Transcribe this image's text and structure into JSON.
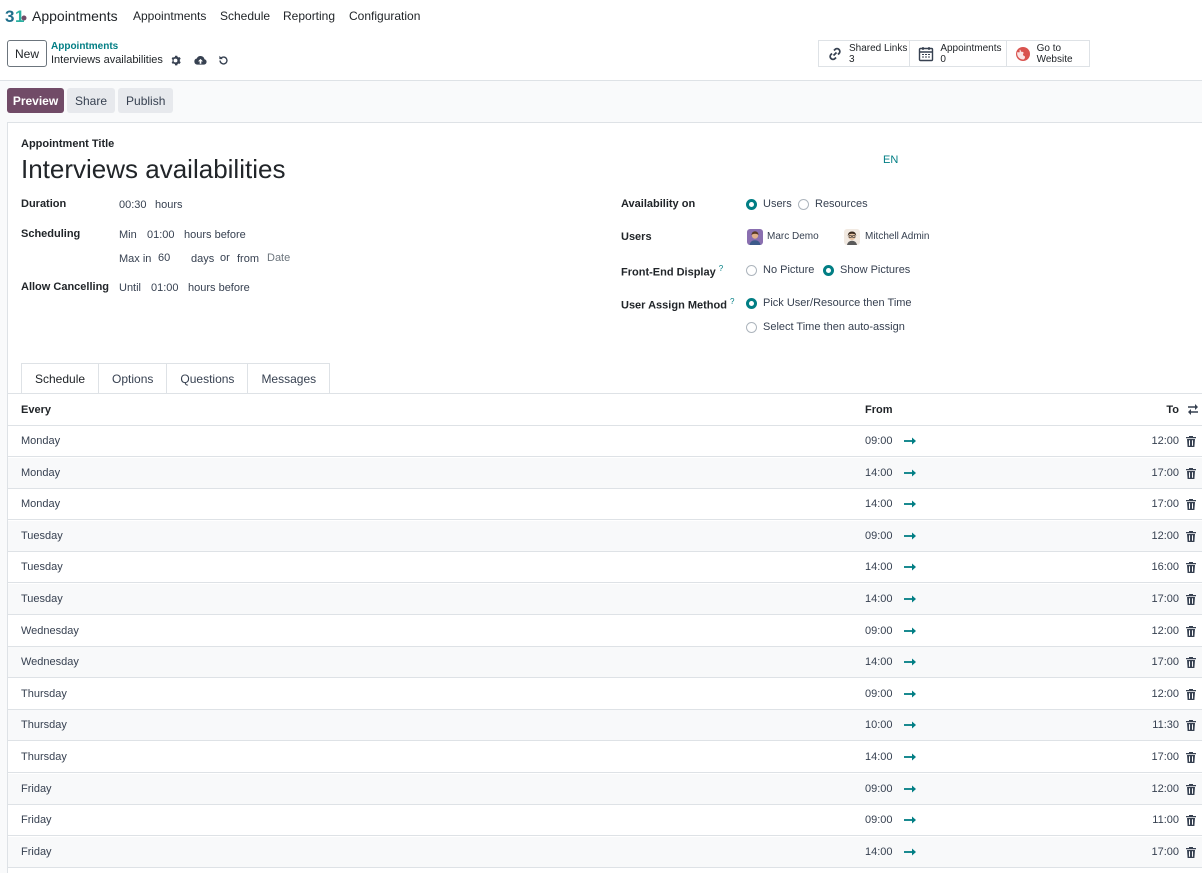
{
  "topnav": {
    "app_name": "Appointments",
    "items": [
      "Appointments",
      "Schedule",
      "Reporting",
      "Configuration"
    ]
  },
  "control": {
    "new_label": "New",
    "breadcrumb_parent": "Appointments",
    "breadcrumb_current": "Interviews availabilities",
    "smart_buttons": [
      {
        "line1": "Shared Links",
        "line2": "3",
        "icon": "link-icon"
      },
      {
        "line1": "Appointments",
        "line2": "0",
        "icon": "calendar-icon"
      },
      {
        "line1": "Go to",
        "line2": "Website",
        "icon": "globe-icon"
      }
    ]
  },
  "statusbar": {
    "preview": "Preview",
    "share": "Share",
    "publish": "Publish"
  },
  "form": {
    "title_label": "Appointment Title",
    "title": "Interviews availabilities",
    "lang": "EN",
    "duration": {
      "label": "Duration",
      "value": "00:30",
      "unit": "hours"
    },
    "scheduling": {
      "label": "Scheduling",
      "min_label": "Min",
      "min_value": "01:00",
      "min_suffix": "hours before",
      "max_label": "Max in",
      "max_value": "60",
      "max_days": "days",
      "or": "or",
      "from": "from",
      "date_placeholder": "Date"
    },
    "cancelling": {
      "label": "Allow Cancelling",
      "until": "Until",
      "value": "01:00",
      "suffix": "hours before"
    },
    "availability": {
      "label": "Availability on",
      "opt1": "Users",
      "opt2": "Resources",
      "selected": "Users"
    },
    "users": {
      "label": "Users",
      "list": [
        "Marc Demo",
        "Mitchell Admin"
      ]
    },
    "frontend": {
      "label": "Front-End Display",
      "help": "?",
      "opt1": "No Picture",
      "opt2": "Show Pictures",
      "selected": "Show Pictures"
    },
    "assign": {
      "label": "User Assign Method",
      "help": "?",
      "opt1": "Pick User/Resource then Time",
      "opt2": "Select Time then auto-assign",
      "selected": "Pick User/Resource then Time"
    }
  },
  "tabs": [
    {
      "label": "Schedule",
      "active": true
    },
    {
      "label": "Options",
      "active": false
    },
    {
      "label": "Questions",
      "active": false
    },
    {
      "label": "Messages",
      "active": false
    }
  ],
  "table": {
    "headers": {
      "every": "Every",
      "from": "From",
      "to": "To"
    },
    "rows": [
      {
        "day": "Monday",
        "from": "09:00",
        "to": "12:00"
      },
      {
        "day": "Monday",
        "from": "14:00",
        "to": "17:00"
      },
      {
        "day": "Monday",
        "from": "14:00",
        "to": "17:00"
      },
      {
        "day": "Tuesday",
        "from": "09:00",
        "to": "12:00"
      },
      {
        "day": "Tuesday",
        "from": "14:00",
        "to": "16:00"
      },
      {
        "day": "Tuesday",
        "from": "14:00",
        "to": "17:00"
      },
      {
        "day": "Wednesday",
        "from": "09:00",
        "to": "12:00"
      },
      {
        "day": "Wednesday",
        "from": "14:00",
        "to": "17:00"
      },
      {
        "day": "Thursday",
        "from": "09:00",
        "to": "12:00"
      },
      {
        "day": "Thursday",
        "from": "10:00",
        "to": "11:30"
      },
      {
        "day": "Thursday",
        "from": "14:00",
        "to": "17:00"
      },
      {
        "day": "Friday",
        "from": "09:00",
        "to": "12:00"
      },
      {
        "day": "Friday",
        "from": "09:00",
        "to": "11:00"
      },
      {
        "day": "Friday",
        "from": "14:00",
        "to": "17:00"
      }
    ]
  },
  "colors": {
    "brand": "#714b67",
    "accent": "#017e84",
    "arrow": "#017e84"
  }
}
